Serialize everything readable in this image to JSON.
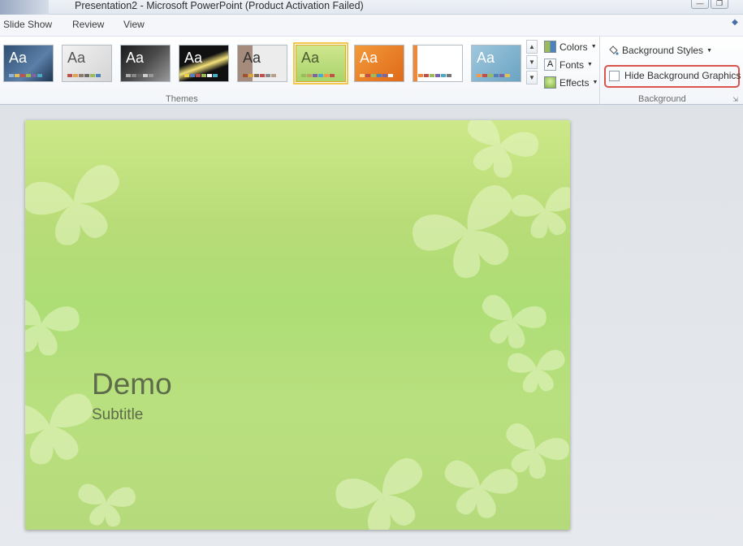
{
  "window": {
    "title": "Presentation2  -  Microsoft PowerPoint (Product Activation Failed)"
  },
  "tabs": [
    {
      "label": "Slide Show"
    },
    {
      "label": "Review"
    },
    {
      "label": "View"
    }
  ],
  "ribbon": {
    "themes_group": {
      "label": "Themes",
      "thumb_text": "Aa",
      "selected_index": 5,
      "options": [
        {
          "label": "Colors",
          "icon": "colors-icon"
        },
        {
          "label": "Fonts",
          "icon": "fonts-icon",
          "glyph": "A"
        },
        {
          "label": "Effects",
          "icon": "effects-icon"
        }
      ]
    },
    "background_group": {
      "label": "Background",
      "styles_label": "Background Styles",
      "hide_label": "Hide Background Graphics",
      "hide_checked": false
    }
  },
  "slide": {
    "title": "Demo",
    "subtitle": "Subtitle"
  },
  "colors": {
    "highlight": "#d9534f",
    "selected_outline": "#f1c84a",
    "slide_green": "#b8dc78"
  }
}
